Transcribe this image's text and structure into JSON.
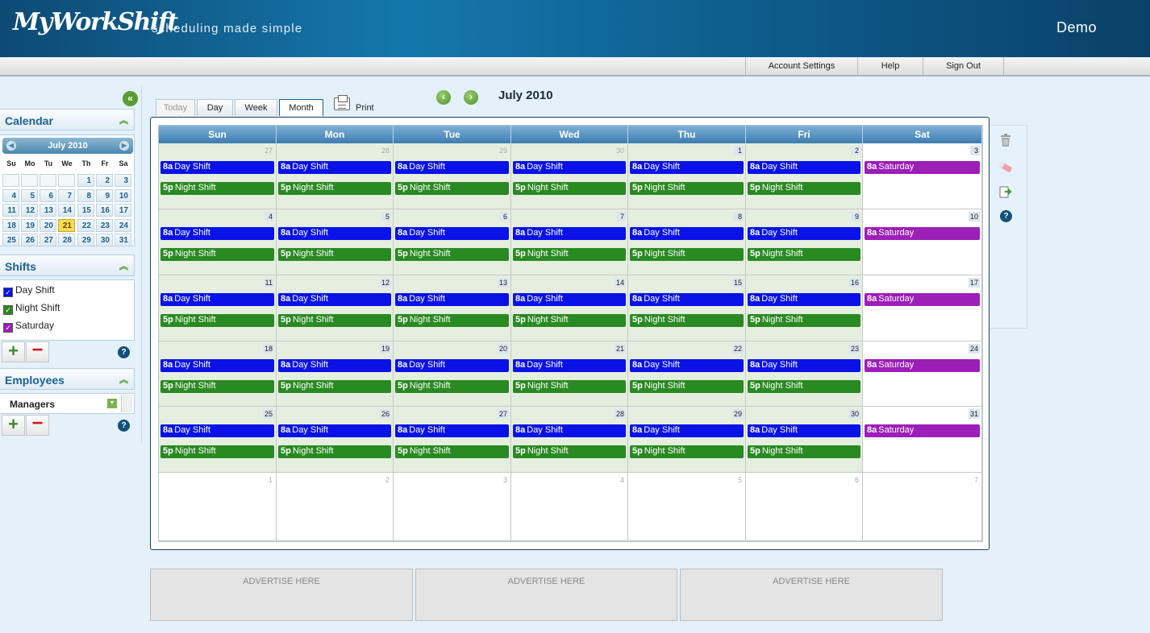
{
  "header": {
    "logo": "MyWorkShift",
    "tagline": "scheduling made simple",
    "user": "Demo"
  },
  "topnav": [
    "Account Settings",
    "Help",
    "Sign Out"
  ],
  "sidebar": {
    "calendar_title": "Calendar",
    "mini_calendar": {
      "month": "July 2010",
      "weekdays": [
        "Su",
        "Mo",
        "Tu",
        "We",
        "Th",
        "Fr",
        "Sa"
      ],
      "weeks": [
        [
          "",
          "",
          "",
          "",
          "1",
          "2",
          "3"
        ],
        [
          "4",
          "5",
          "6",
          "7",
          "8",
          "9",
          "10"
        ],
        [
          "11",
          "12",
          "13",
          "14",
          "15",
          "16",
          "17"
        ],
        [
          "18",
          "19",
          "20",
          "21",
          "22",
          "23",
          "24"
        ],
        [
          "25",
          "26",
          "27",
          "28",
          "29",
          "30",
          "31"
        ]
      ],
      "today": "21"
    },
    "shifts_title": "Shifts",
    "shifts": [
      {
        "label": "Day Shift",
        "color": "#0a12e8"
      },
      {
        "label": "Night Shift",
        "color": "#2a8a22"
      },
      {
        "label": "Saturday",
        "color": "#9c1fb8"
      }
    ],
    "employees_title": "Employees",
    "employee_group": "Managers"
  },
  "toolbar": {
    "views": [
      "Today",
      "Day",
      "Week",
      "Month"
    ],
    "active_view": "Month",
    "print": "Print",
    "month_title": "July 2010"
  },
  "calendar": {
    "weekdays": [
      "Sun",
      "Mon",
      "Tue",
      "Wed",
      "Thu",
      "Fri",
      "Sat"
    ],
    "weeks": [
      [
        {
          "d": "27",
          "o": true
        },
        {
          "d": "28",
          "o": true
        },
        {
          "d": "29",
          "o": true
        },
        {
          "d": "30",
          "o": true
        },
        {
          "d": "1"
        },
        {
          "d": "2"
        },
        {
          "d": "3"
        }
      ],
      [
        {
          "d": "4"
        },
        {
          "d": "5"
        },
        {
          "d": "6"
        },
        {
          "d": "7"
        },
        {
          "d": "8"
        },
        {
          "d": "9"
        },
        {
          "d": "10"
        }
      ],
      [
        {
          "d": "11"
        },
        {
          "d": "12"
        },
        {
          "d": "13"
        },
        {
          "d": "14"
        },
        {
          "d": "15"
        },
        {
          "d": "16"
        },
        {
          "d": "17"
        }
      ],
      [
        {
          "d": "18"
        },
        {
          "d": "19"
        },
        {
          "d": "20"
        },
        {
          "d": "21"
        },
        {
          "d": "22"
        },
        {
          "d": "23"
        },
        {
          "d": "24"
        }
      ],
      [
        {
          "d": "25"
        },
        {
          "d": "26"
        },
        {
          "d": "27"
        },
        {
          "d": "28"
        },
        {
          "d": "29"
        },
        {
          "d": "30"
        },
        {
          "d": "31"
        }
      ],
      [
        {
          "d": "1",
          "o": true
        },
        {
          "d": "2",
          "o": true
        },
        {
          "d": "3",
          "o": true
        },
        {
          "d": "4",
          "o": true
        },
        {
          "d": "5",
          "o": true
        },
        {
          "d": "6",
          "o": true
        },
        {
          "d": "7",
          "o": true
        }
      ]
    ],
    "weekday_shifts": [
      {
        "time": "8a",
        "name": "Day Shift",
        "type": "day"
      },
      {
        "time": "5p",
        "name": "Night Shift",
        "type": "night"
      }
    ],
    "saturday_shifts": [
      {
        "time": "8a",
        "name": "Saturday",
        "type": "sat"
      }
    ]
  },
  "ads": [
    "ADVERTISE HERE",
    "ADVERTISE HERE",
    "ADVERTISE HERE"
  ],
  "icons": [
    "trash-icon",
    "eraser-icon",
    "export-icon",
    "help-icon"
  ]
}
